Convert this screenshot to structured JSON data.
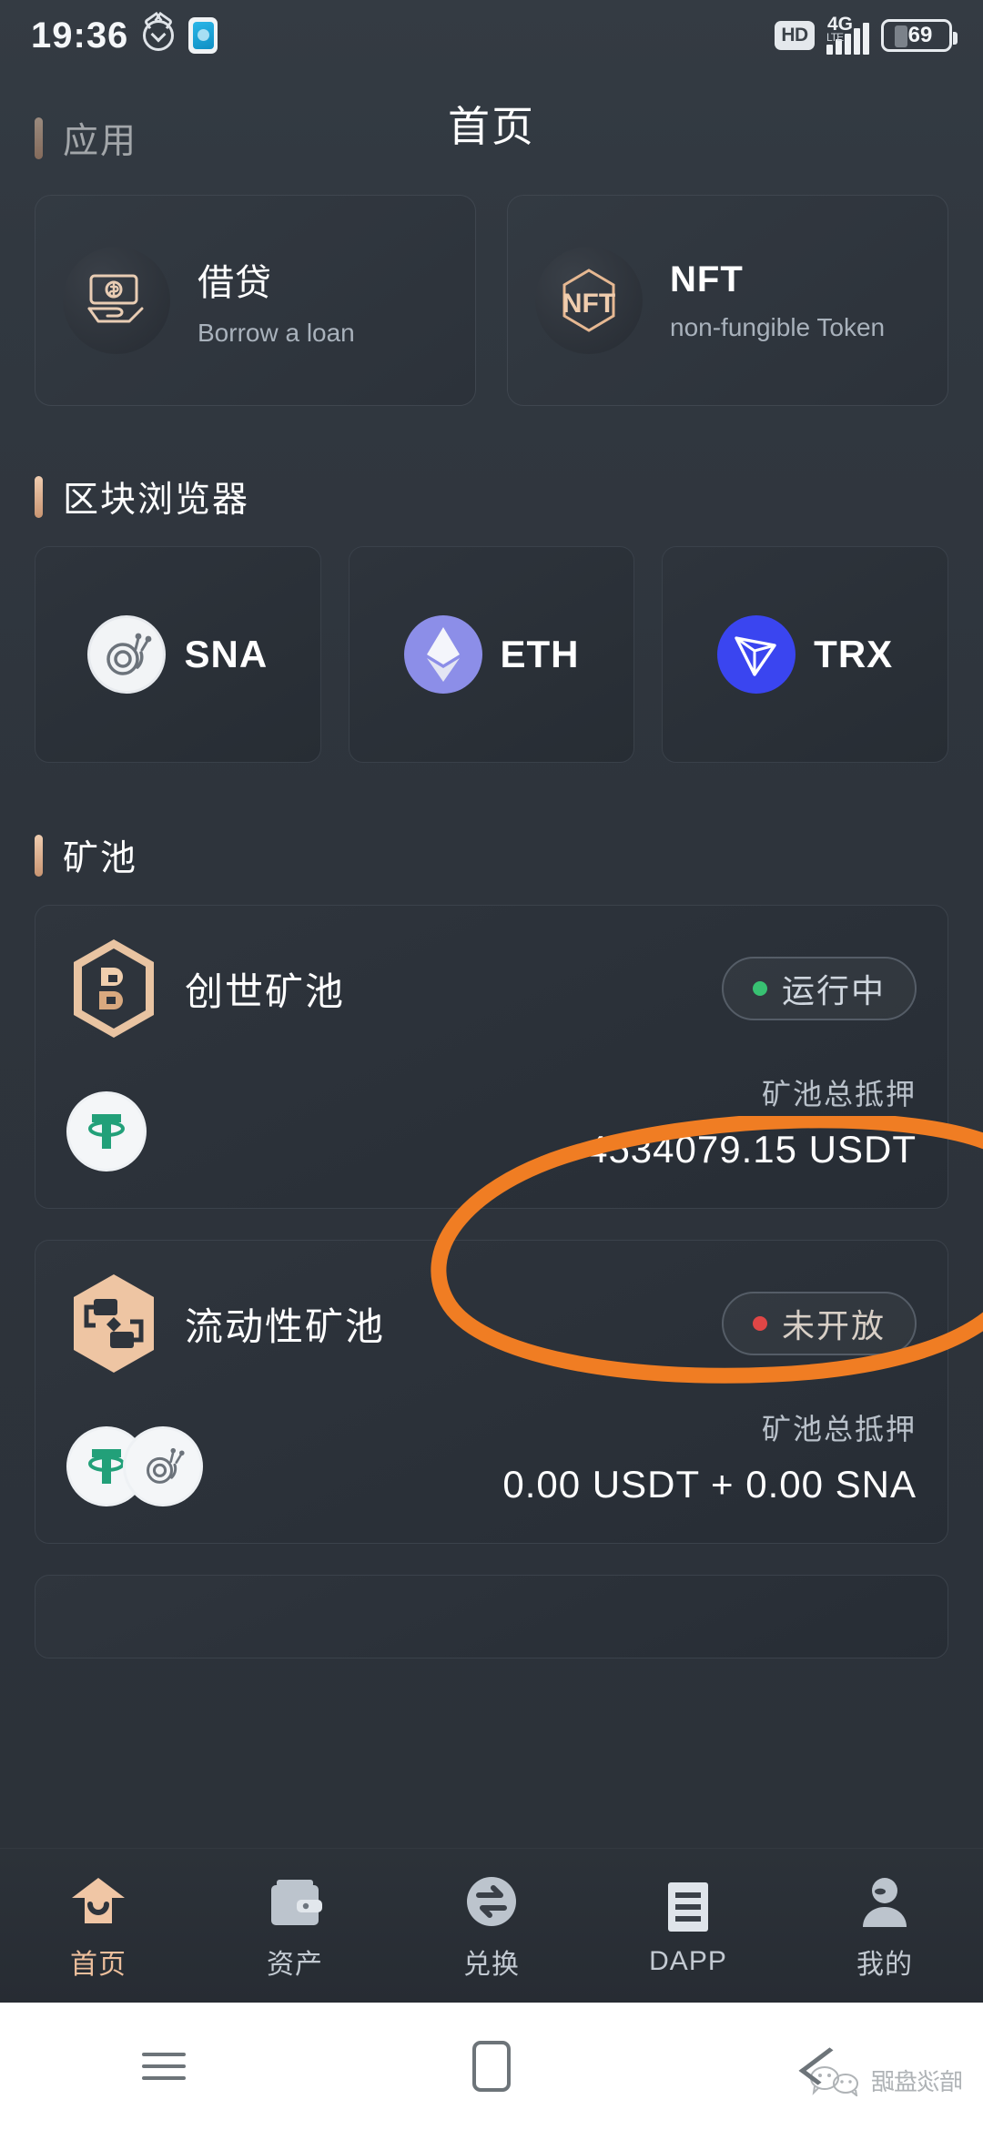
{
  "status_bar": {
    "time": "19:36",
    "alarm_icon": "alarm-clock-icon",
    "app_icon": "app-notification-icon",
    "hd_label": "HD",
    "network_label": "4G",
    "network_sub": "LTE",
    "battery_level": "69"
  },
  "header": {
    "title": "首页"
  },
  "sections": {
    "apps": {
      "label": "应用"
    },
    "explorer": {
      "label": "区块浏览器"
    },
    "pools": {
      "label": "矿池"
    }
  },
  "apps": [
    {
      "icon": "loan-wallet-icon",
      "name": "借贷",
      "subtitle": "Borrow a loan"
    },
    {
      "icon": "nft-icon",
      "name": "NFT",
      "subtitle": "non-fungible Token"
    }
  ],
  "chains": [
    {
      "icon": "snail-icon",
      "name": "SNA"
    },
    {
      "icon": "ethereum-icon",
      "name": "ETH"
    },
    {
      "icon": "tron-icon",
      "name": "TRX"
    }
  ],
  "pools": [
    {
      "logo": "genesis-pool-icon",
      "name": "创世矿池",
      "status": "运行中",
      "status_color": "#38c172",
      "coins": [
        "usdt-icon"
      ],
      "stake_label": "矿池总抵押",
      "stake_value": "4534079.15 USDT"
    },
    {
      "logo": "liquidity-pool-icon",
      "name": "流动性矿池",
      "status": "未开放",
      "status_color": "#e04646",
      "coins": [
        "usdt-icon",
        "sna-icon"
      ],
      "stake_label": "矿池总抵押",
      "stake_value": "0.00 USDT + 0.00 SNA"
    }
  ],
  "annotation": {
    "shape": "orange-ellipse-highlight",
    "color": "#f07d23"
  },
  "tabs": [
    {
      "icon": "home-icon",
      "label": "首页",
      "active": true
    },
    {
      "icon": "wallet-icon",
      "label": "资产",
      "active": false
    },
    {
      "icon": "swap-icon",
      "label": "兑换",
      "active": false
    },
    {
      "icon": "dapp-icon",
      "label": "DAPP",
      "active": false
    },
    {
      "icon": "profile-icon",
      "label": "我的",
      "active": false
    }
  ],
  "system_nav": {
    "menu_icon": "menu-icon",
    "home_icon": "home-square-icon",
    "back_icon": "back-chevron-icon",
    "watermark_text": "暗淡盘踞"
  },
  "colors": {
    "background": "#2e343c",
    "card": "#2f353d",
    "accent": "#edbf9c",
    "annotation_orange": "#f07d23",
    "running_green": "#38c172",
    "closed_red": "#e04646"
  }
}
